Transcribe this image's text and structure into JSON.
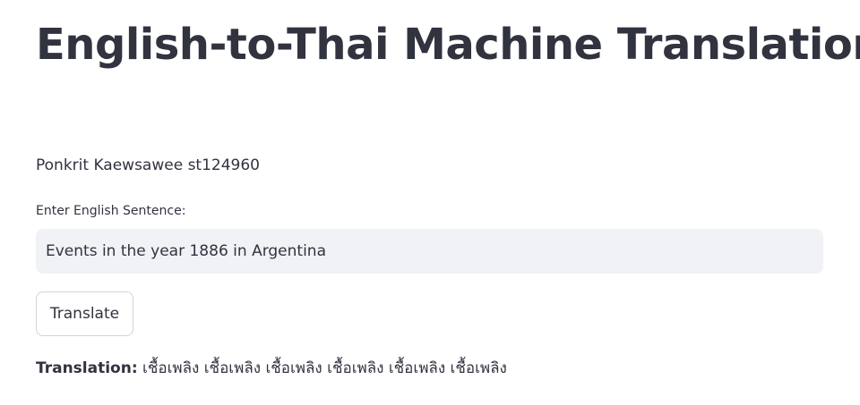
{
  "page": {
    "title": "English-to-Thai Machine Translation",
    "author": "Ponkrit Kaewsawee st124960"
  },
  "form": {
    "input_label": "Enter English Sentence:",
    "input_value": "Events in the year 1886 in Argentina",
    "translate_button_label": "Translate"
  },
  "result": {
    "label": "Translation:",
    "text": "เชื้อเพลิง เชื้อเพลิง เชื้อเพลิง เชื้อเพลิง เชื้อเพลิง เชื้อเพลิง"
  }
}
